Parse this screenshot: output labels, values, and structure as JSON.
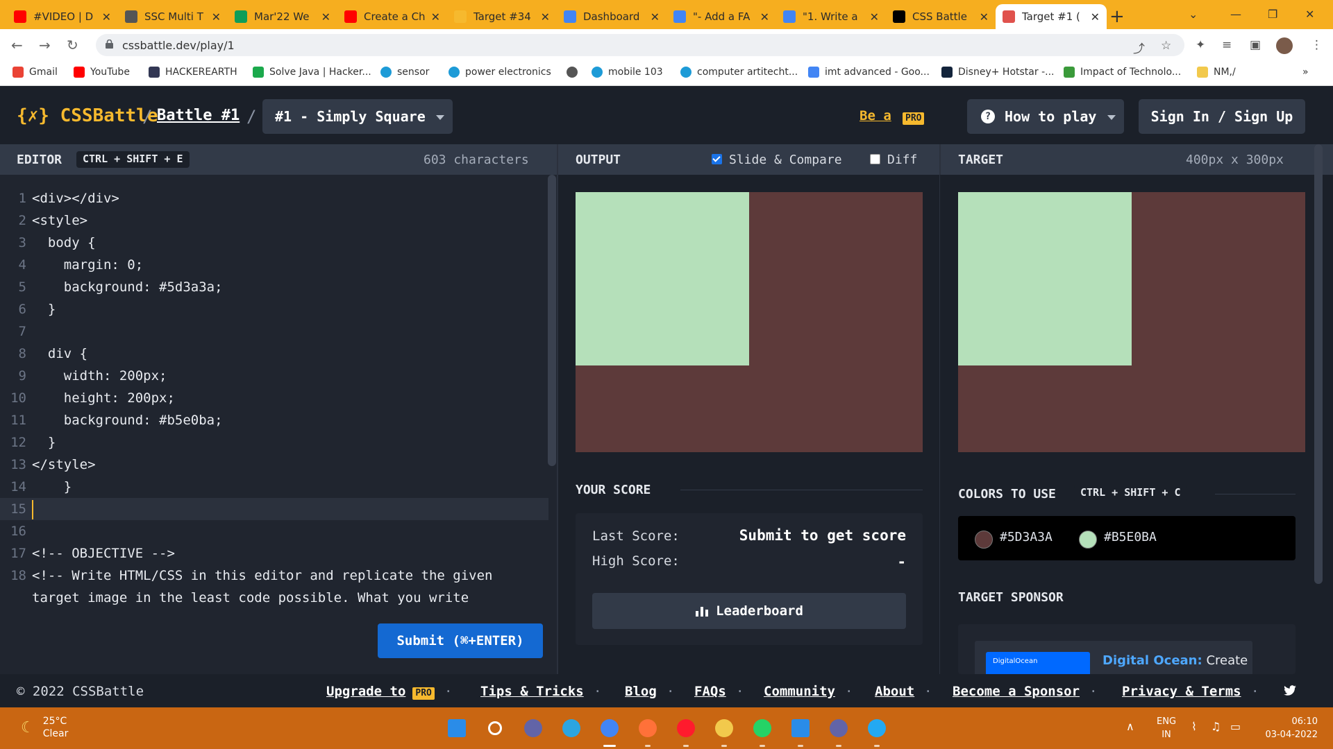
{
  "browser": {
    "tabs": [
      {
        "title": "#VIDEO | D",
        "icon": "youtube-icon",
        "color": "#ff0000"
      },
      {
        "title": "SSC Multi T",
        "icon": "globe-icon",
        "color": "#555555"
      },
      {
        "title": "Mar'22 We",
        "icon": "sheets-icon",
        "color": "#0f9d58"
      },
      {
        "title": "Create a Ch",
        "icon": "youtube-icon",
        "color": "#ff0000"
      },
      {
        "title": "Target #34",
        "icon": "cssbattle-icon",
        "color": "#f6b92e"
      },
      {
        "title": "Dashboard",
        "icon": "google-icon",
        "color": "#4285f4"
      },
      {
        "title": "\"- Add a FA",
        "icon": "google-icon",
        "color": "#4285f4"
      },
      {
        "title": "\"1. Write a",
        "icon": "google-icon",
        "color": "#4285f4"
      },
      {
        "title": "CSS Battle",
        "icon": "dev-icon",
        "color": "#000000"
      },
      {
        "title": "Target #1 (",
        "icon": "cssbattle-icon",
        "color": "#e0524d"
      }
    ],
    "active_tab": 9,
    "url": "cssbattle.dev/play/1",
    "bookmarks": [
      {
        "label": "Gmail",
        "icon": "gmail-icon",
        "color": "#ea4335"
      },
      {
        "label": "YouTube",
        "icon": "youtube-icon",
        "color": "#ff0000"
      },
      {
        "label": "HACKEREARTH",
        "icon": "hackerearth-icon",
        "color": "#323754"
      },
      {
        "label": "Solve Java | Hacker...",
        "icon": "hackerrank-icon",
        "color": "#1ba94c"
      },
      {
        "label": "sensor",
        "icon": "edge-icon",
        "color": "#1d9bd7"
      },
      {
        "label": "power electronics",
        "icon": "edge-icon",
        "color": "#1d9bd7"
      },
      {
        "label": "",
        "icon": "globe-icon",
        "color": "#555555"
      },
      {
        "label": "mobile 103",
        "icon": "edge-icon",
        "color": "#1d9bd7"
      },
      {
        "label": "computer artitecht...",
        "icon": "edge-icon",
        "color": "#1d9bd7"
      },
      {
        "label": "imt advanced - Goo...",
        "icon": "google-icon",
        "color": "#4285f4"
      },
      {
        "label": "Disney+ Hotstar -...",
        "icon": "hotstar-icon",
        "color": "#13243b"
      },
      {
        "label": "Impact of Technolo...",
        "icon": "leaf-icon",
        "color": "#3a9a3a"
      },
      {
        "label": "NM,/",
        "icon": "folder-icon",
        "color": "#f2c94c"
      }
    ],
    "more": "»"
  },
  "site": {
    "logo": "{✗} CSSBattle",
    "breadcrumb_sep": "/",
    "battle": "Battle #1",
    "level": "#1 - Simply Square",
    "be_a": "Be a",
    "pro": "PRO",
    "how_to_play": "How to play",
    "sign_in": "Sign In / Sign Up"
  },
  "editor": {
    "title": "EDITOR",
    "shortcut": "CTRL + SHIFT + E",
    "char_count": "603 characters",
    "lines": [
      {
        "n": "1",
        "text": "<div></div>"
      },
      {
        "n": "2",
        "text": "<style>"
      },
      {
        "n": "3",
        "text": "  body {"
      },
      {
        "n": "4",
        "text": "    margin: 0;"
      },
      {
        "n": "5",
        "text": "    background: #5d3a3a;"
      },
      {
        "n": "6",
        "text": "  }"
      },
      {
        "n": "7",
        "text": ""
      },
      {
        "n": "8",
        "text": "  div {"
      },
      {
        "n": "9",
        "text": "    width: 200px;"
      },
      {
        "n": "10",
        "text": "    height: 200px;"
      },
      {
        "n": "11",
        "text": "    background: #b5e0ba;"
      },
      {
        "n": "12",
        "text": "  }"
      },
      {
        "n": "13",
        "text": "</style>"
      },
      {
        "n": "14",
        "text": "    }"
      },
      {
        "n": "15",
        "text": ""
      },
      {
        "n": "16",
        "text": ""
      },
      {
        "n": "17",
        "text": "<!-- OBJECTIVE -->"
      },
      {
        "n": "18",
        "text": "<!-- Write HTML/CSS in this editor and replicate the given"
      },
      {
        "n": "",
        "text": "target image in the least code possible. What you write"
      }
    ],
    "current_line": 15,
    "submit": "Submit (⌘+ENTER)"
  },
  "output": {
    "title": "OUTPUT",
    "slide_compare": "Slide & Compare",
    "slide_compare_checked": true,
    "diff": "Diff",
    "diff_checked": false,
    "background": "#5d3a3a",
    "square": "#b5e0ba"
  },
  "score": {
    "title": "YOUR SCORE",
    "last_label": "Last Score:",
    "last_value": "Submit to get score",
    "high_label": "High Score:",
    "high_value": "-",
    "leaderboard": "Leaderboard"
  },
  "target": {
    "title": "TARGET",
    "size": "400px x 300px",
    "background": "#5d3a3a",
    "square": "#b5e0ba",
    "colors_title": "COLORS TO USE",
    "colors_shortcut": "CTRL + SHIFT + C",
    "colors": [
      {
        "hex": "#5D3A3A",
        "value": "#5d3a3a"
      },
      {
        "hex": "#B5E0BA",
        "value": "#b5e0ba"
      }
    ],
    "sponsor_title": "TARGET SPONSOR",
    "sponsor_name": "Digital Ocean:",
    "sponsor_text": "Create",
    "sponsor_logo": "DigitalOcean"
  },
  "footer": {
    "copyright": "© 2022 CSSBattle",
    "links": [
      "Upgrade to",
      "Tips & Tricks",
      "Blog",
      "FAQs",
      "Community",
      "About",
      "Become a Sponsor",
      "Privacy & Terms"
    ],
    "pro": "PRO",
    "sep": "·"
  },
  "taskbar": {
    "temp": "25°C",
    "weather": "Clear",
    "lang1": "ENG",
    "lang2": "IN",
    "time": "06:10",
    "date": "03-04-2022",
    "apps": [
      {
        "name": "windows-start-icon",
        "color": "#2a8ce8"
      },
      {
        "name": "search-icon",
        "color": "#ffffff"
      },
      {
        "name": "teams-meet-icon",
        "color": "#6264a7"
      },
      {
        "name": "telegram-icon",
        "color": "#2ca5e0"
      },
      {
        "name": "chrome-icon",
        "color": "#4285f4"
      },
      {
        "name": "firefox-icon",
        "color": "#ff7139"
      },
      {
        "name": "opera-icon",
        "color": "#ff1b2d"
      },
      {
        "name": "file-explorer-icon",
        "color": "#f2c94c"
      },
      {
        "name": "whatsapp-icon",
        "color": "#25d366"
      },
      {
        "name": "store-icon",
        "color": "#2a8ce8"
      },
      {
        "name": "teams-icon",
        "color": "#6264a7"
      },
      {
        "name": "vscode-icon",
        "color": "#23a9f2"
      }
    ]
  }
}
